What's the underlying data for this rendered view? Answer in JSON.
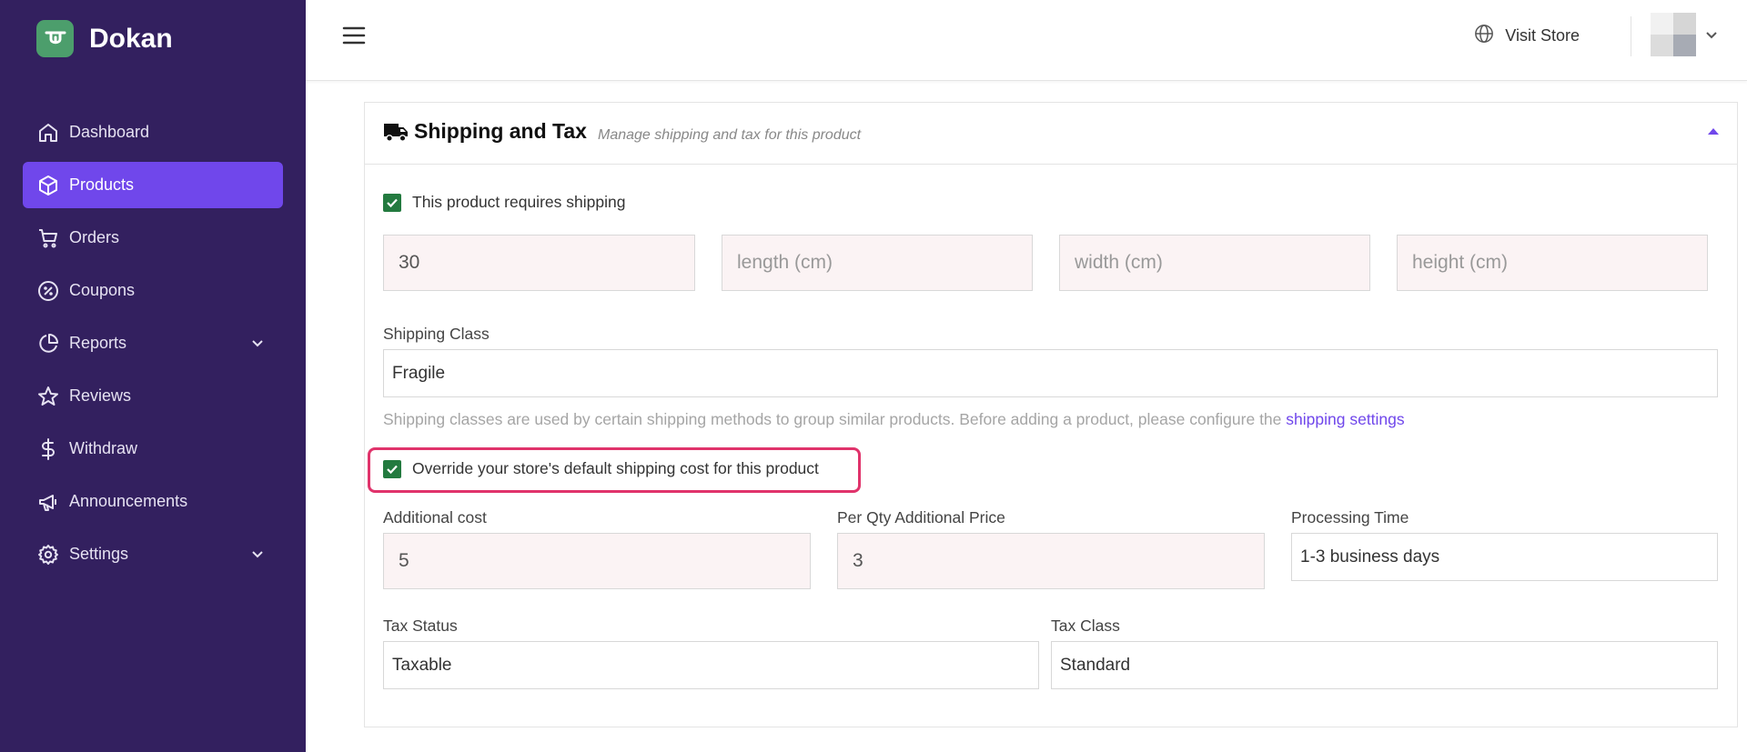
{
  "brand": {
    "name": "Dokan",
    "logo_icon": "dokan-logo-icon",
    "logo_color": "#4c9e6c"
  },
  "sidebar": {
    "background": "#33205f",
    "active_color": "#7047eb",
    "items": [
      {
        "label": "Dashboard",
        "icon": "home-icon",
        "active": false
      },
      {
        "label": "Products",
        "icon": "box-icon",
        "active": true
      },
      {
        "label": "Orders",
        "icon": "cart-icon",
        "active": false
      },
      {
        "label": "Coupons",
        "icon": "coupon-icon",
        "active": false
      },
      {
        "label": "Reports",
        "icon": "pie-chart-icon",
        "active": false,
        "has_submenu": true
      },
      {
        "label": "Reviews",
        "icon": "star-icon",
        "active": false
      },
      {
        "label": "Withdraw",
        "icon": "dollar-icon",
        "active": false
      },
      {
        "label": "Announcements",
        "icon": "megaphone-icon",
        "active": false
      },
      {
        "label": "Settings",
        "icon": "gear-icon",
        "active": false,
        "has_submenu": true
      }
    ]
  },
  "topbar": {
    "menu_icon": "hamburger-icon",
    "visit_store_label": "Visit Store",
    "visit_store_icon": "globe-icon"
  },
  "panel": {
    "title": "Shipping and Tax",
    "subtitle": "Manage shipping and tax for this product",
    "title_icon": "truck-icon",
    "requires_shipping": {
      "checked": true,
      "label": "This product requires shipping"
    },
    "dimensions": {
      "weight_value": "30",
      "length_placeholder": "length (cm)",
      "width_placeholder": "width (cm)",
      "height_placeholder": "height (cm)"
    },
    "shipping_class": {
      "label": "Shipping Class",
      "value": "Fragile",
      "help_text": "Shipping classes are used by certain shipping methods to group similar products. Before adding a product, please configure the",
      "help_link": "shipping settings"
    },
    "override": {
      "checked": true,
      "label": "Override your store's default shipping cost for this product",
      "highlight_color": "#e0336b"
    },
    "additional_cost": {
      "label": "Additional cost",
      "value": "5"
    },
    "per_qty_price": {
      "label": "Per Qty Additional Price",
      "value": "3"
    },
    "processing_time": {
      "label": "Processing Time",
      "value": "1-3 business days"
    },
    "tax_status": {
      "label": "Tax Status",
      "value": "Taxable"
    },
    "tax_class": {
      "label": "Tax Class",
      "value": "Standard"
    },
    "checkbox_color": "#237a3f"
  }
}
